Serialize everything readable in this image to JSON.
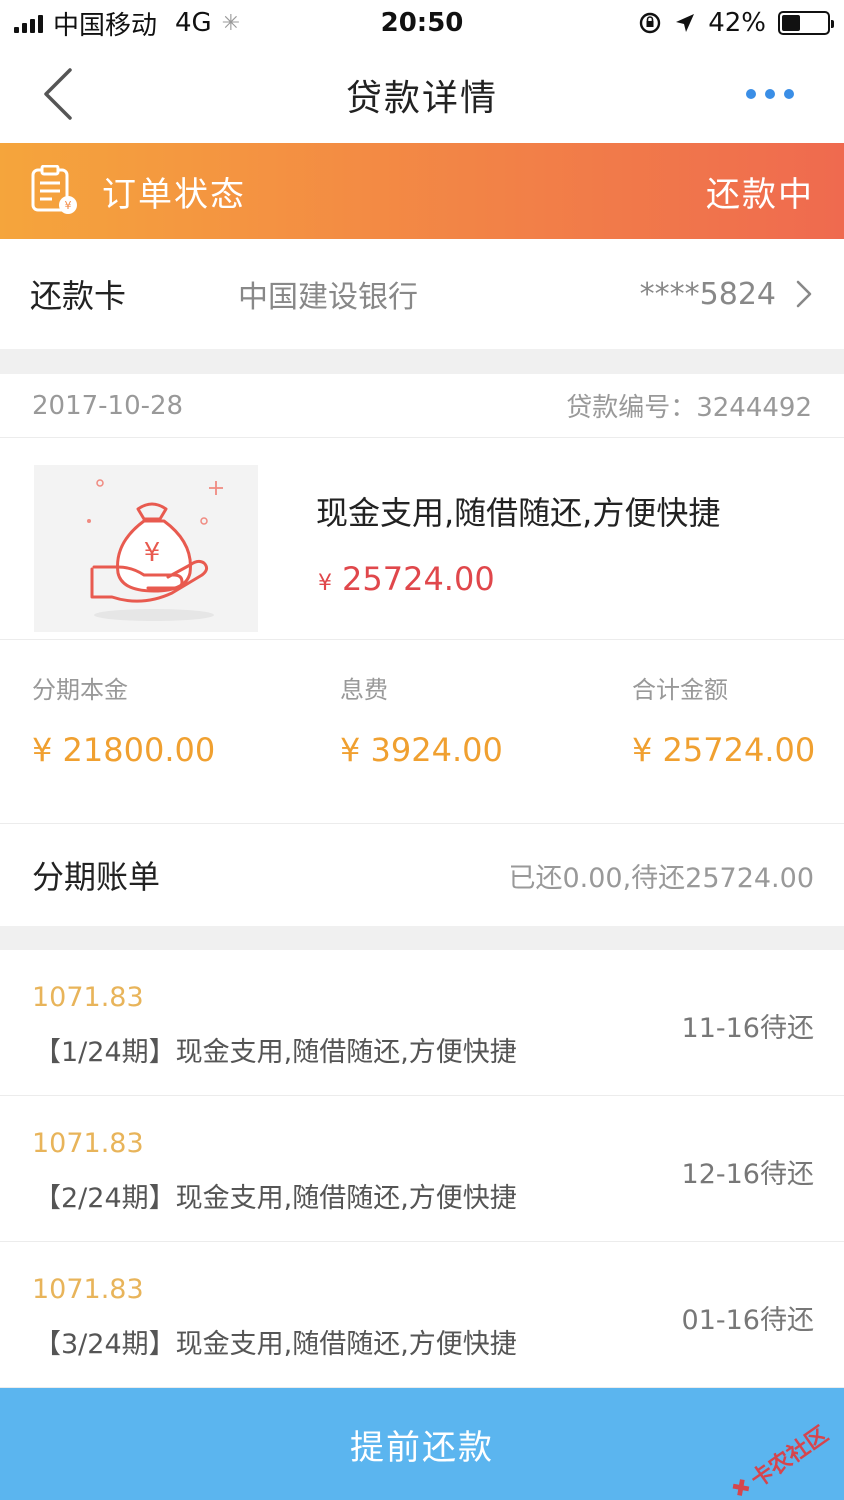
{
  "status_bar": {
    "carrier": "中国移动",
    "network": "4G",
    "time": "20:50",
    "battery": "42%",
    "battery_level": 0.42
  },
  "nav": {
    "title": "贷款详情"
  },
  "order": {
    "label": "订单状态",
    "status": "还款中"
  },
  "repay_card": {
    "label": "还款卡",
    "bank": "中国建设银行",
    "card_number": "****5824"
  },
  "loan": {
    "date": "2017-10-28",
    "loan_no": "贷款编号：3244492",
    "product_title": "现金支用,随借随还,方便快捷",
    "currency_symbol": "¥",
    "total": "25724.00"
  },
  "amounts": {
    "principal_label": "分期本金",
    "principal": "¥ 21800.00",
    "fee_label": "息费",
    "fee": "¥ 3924.00",
    "total_label": "合计金额",
    "total": "¥ 25724.00"
  },
  "installments": {
    "title": "分期账单",
    "summary": "已还0.00,待还25724.00",
    "items": [
      {
        "amount": "1071.83",
        "desc": "【1/24期】现金支用,随借随还,方便快捷",
        "due": "11-16待还"
      },
      {
        "amount": "1071.83",
        "desc": "【2/24期】现金支用,随借随还,方便快捷",
        "due": "12-16待还"
      },
      {
        "amount": "1071.83",
        "desc": "【3/24期】现金支用,随借随还,方便快捷",
        "due": "01-16待还"
      }
    ]
  },
  "footer": {
    "button": "提前还款"
  },
  "watermark": "卡农社区",
  "colors": {
    "accent_blue": "#5bb5ef",
    "banner_start": "#f5a53c",
    "banner_end": "#ef6a4f",
    "amount_red": "#e0474b",
    "amount_orange": "#f0a030"
  }
}
